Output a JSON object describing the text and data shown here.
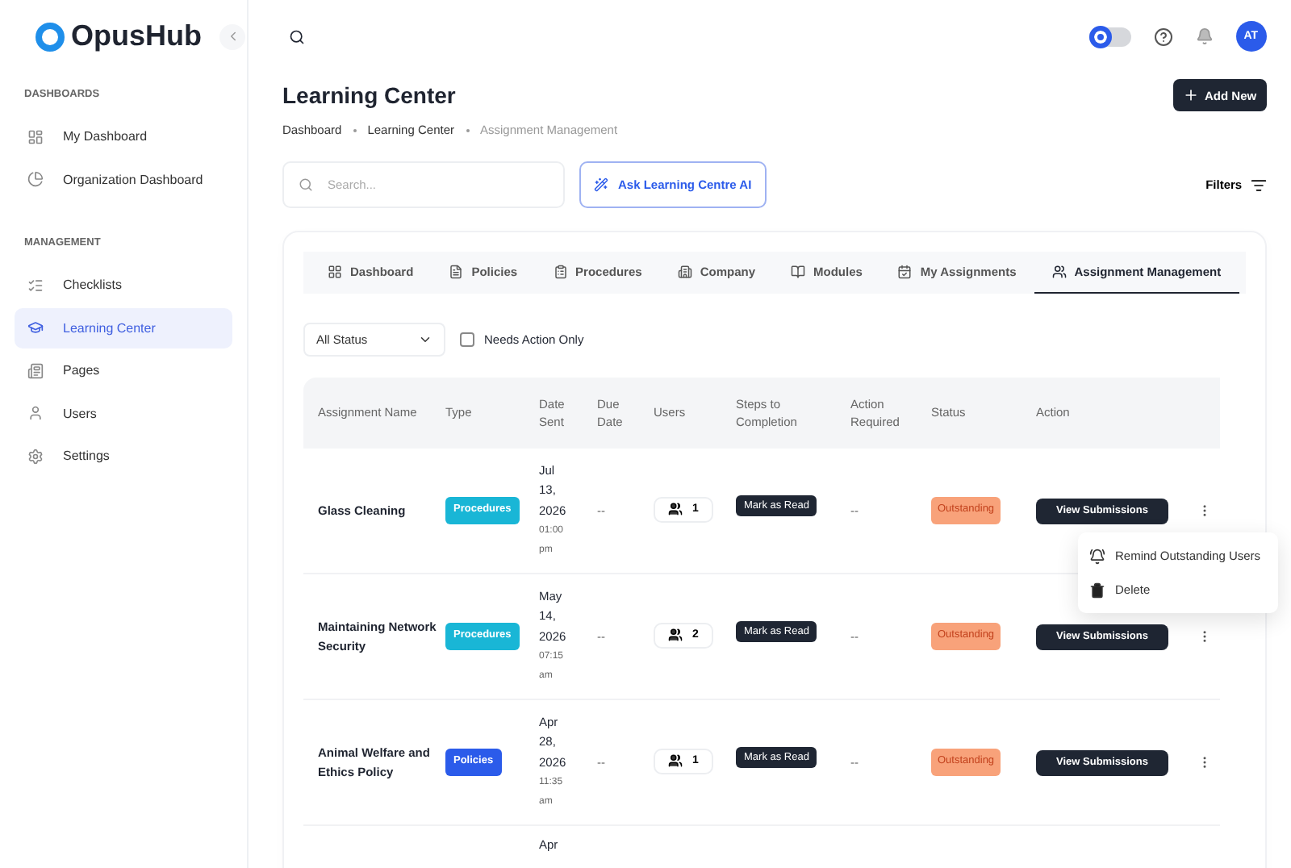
{
  "brand": {
    "name": "OpusHub"
  },
  "sidebar": {
    "sections": [
      {
        "title": "DASHBOARDS",
        "items": [
          {
            "label": "My Dashboard",
            "selected": false
          },
          {
            "label": "Organization Dashboard",
            "selected": false
          }
        ]
      },
      {
        "title": "MANAGEMENT",
        "items": [
          {
            "label": "Checklists",
            "selected": false
          },
          {
            "label": "Learning Center",
            "selected": true
          },
          {
            "label": "Pages",
            "selected": false
          },
          {
            "label": "Users",
            "selected": false
          },
          {
            "label": "Settings",
            "selected": false
          }
        ]
      }
    ]
  },
  "topbar": {
    "theme_toggle": {
      "on": false
    },
    "avatar": "AT"
  },
  "page": {
    "title": "Learning Center",
    "breadcrumbs": [
      "Dashboard",
      "Learning Center",
      "Assignment Management"
    ],
    "add_button": "Add New"
  },
  "search": {
    "placeholder": "Search..."
  },
  "ai_button": "Ask Learning Centre AI",
  "filters_button": "Filters",
  "tabs": [
    {
      "label": "Dashboard",
      "selected": false
    },
    {
      "label": "Policies",
      "selected": false
    },
    {
      "label": "Procedures",
      "selected": false
    },
    {
      "label": "Company",
      "selected": false
    },
    {
      "label": "Modules",
      "selected": false
    },
    {
      "label": "My Assignments",
      "selected": false
    },
    {
      "label": "Assignment Management",
      "selected": true
    }
  ],
  "status_select": {
    "value": "All Status"
  },
  "needs_action": {
    "label": "Needs Action Only",
    "checked": false
  },
  "table": {
    "columns": [
      "Assignment Name",
      "Type",
      "Date Sent",
      "Due Date",
      "Users",
      "Steps to Completion",
      "Action Required",
      "Status",
      "Action"
    ],
    "rows": [
      {
        "name": "Glass Cleaning",
        "type": {
          "label": "Procedures",
          "color": "#19b6d6"
        },
        "date": "Jul 13, 2026",
        "time": "01:00 pm",
        "due": "--",
        "users": "1",
        "step": "Mark as Read",
        "action_required": "--",
        "status": "Outstanding",
        "action": "View Submissions"
      },
      {
        "name": "Maintaining Network Security",
        "type": {
          "label": "Procedures",
          "color": "#19b6d6"
        },
        "date": "May 14, 2026",
        "time": "07:15 am",
        "due": "--",
        "users": "2",
        "step": "Mark as Read",
        "action_required": "--",
        "status": "Outstanding",
        "action": "View Submissions"
      },
      {
        "name": "Animal Welfare and Ethics Policy",
        "type": {
          "label": "Policies",
          "color": "#2b5bea"
        },
        "date": "Apr 28, 2026",
        "time": "11:35 am",
        "due": "--",
        "users": "1",
        "step": "Mark as Read",
        "action_required": "--",
        "status": "Outstanding",
        "action": "View Submissions"
      },
      {
        "date": "Apr"
      }
    ]
  },
  "row_menu": {
    "items": [
      {
        "kind": "remind",
        "label": "Remind Outstanding Users"
      },
      {
        "kind": "delete",
        "label": "Delete"
      }
    ]
  }
}
